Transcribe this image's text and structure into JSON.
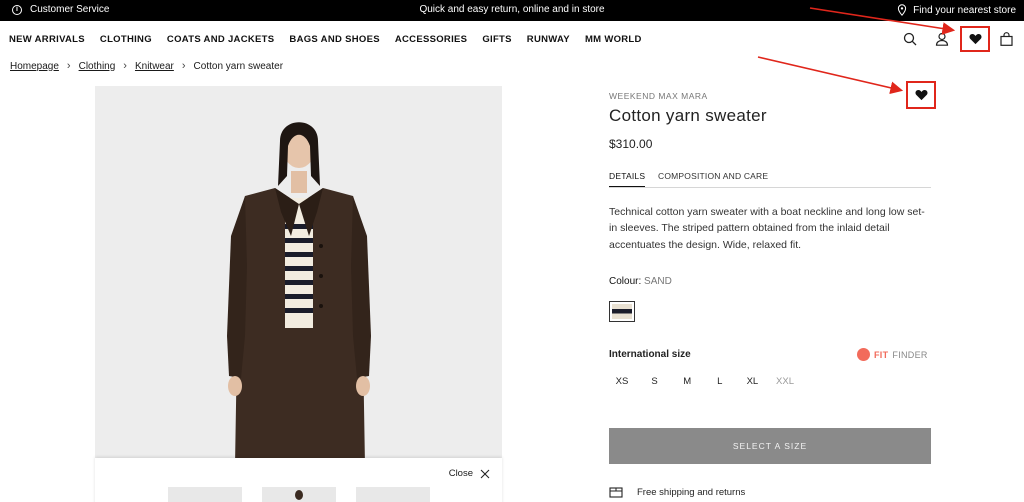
{
  "topbar": {
    "customer_service": "Customer Service",
    "promo": "Quick and easy return, online and in store",
    "store_finder": "Find your nearest store"
  },
  "nav": {
    "items": [
      "NEW ARRIVALS",
      "CLOTHING",
      "COATS AND JACKETS",
      "BAGS AND SHOES",
      "ACCESSORIES",
      "GIFTS",
      "RUNWAY",
      "MM WORLD"
    ],
    "icons": [
      "search-icon",
      "user-icon",
      "heart-icon",
      "bag-icon"
    ]
  },
  "breadcrumb": [
    "Homepage",
    "Clothing",
    "Knitwear",
    "Cotton yarn sweater"
  ],
  "product": {
    "brand": "WEEKEND MAX MARA",
    "title": "Cotton yarn sweater",
    "price": "$310.00",
    "tabs": [
      "DETAILS",
      "COMPOSITION AND CARE"
    ],
    "active_tab": "DETAILS",
    "description": "Technical cotton yarn sweater with a boat neckline and long low set-in sleeves. The striped pattern obtained from the inlaid detail accentuates the design. Wide, relaxed fit.",
    "colour_label": "Colour:",
    "colour_value": "SAND",
    "size_label": "International size",
    "fit_finder_1": "FIT",
    "fit_finder_2": "FINDER",
    "sizes": [
      "XS",
      "S",
      "M",
      "L",
      "XL",
      "XXL"
    ],
    "unavailable_sizes": [
      "XXL"
    ],
    "select_button": "SELECT A SIZE",
    "shipping": "Free shipping and returns"
  },
  "gallery": {
    "close_label": "Close"
  },
  "colors": {
    "annotation_red": "#e0261b",
    "button_gray": "#8a8a8a",
    "fit_finder": "#f26b5b"
  }
}
